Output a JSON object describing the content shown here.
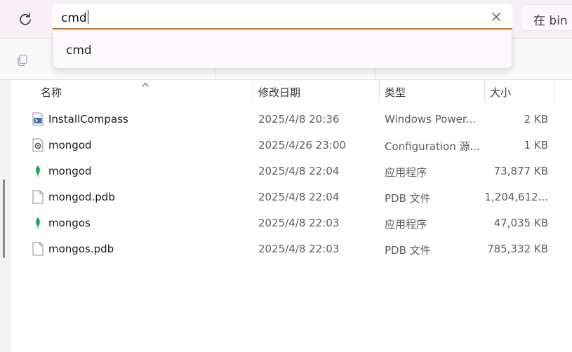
{
  "address_bar": {
    "value": "cmd"
  },
  "search": {
    "placeholder": "在 bin 中"
  },
  "suggestions": [
    {
      "label": "cmd"
    }
  ],
  "columns": {
    "name": "名称",
    "date": "修改日期",
    "type": "类型",
    "size": "大小"
  },
  "files": [
    {
      "icon": "powershell-script-icon",
      "name": "InstallCompass",
      "date": "2025/4/8 20:36",
      "type": "Windows Power...",
      "size": "2 KB"
    },
    {
      "icon": "config-file-icon",
      "name": "mongod",
      "date": "2025/4/26 23:00",
      "type": "Configuration 源...",
      "size": "1 KB"
    },
    {
      "icon": "mongodb-leaf-icon",
      "name": "mongod",
      "date": "2025/4/8 22:04",
      "type": "应用程序",
      "size": "73,877 KB"
    },
    {
      "icon": "blank-file-icon",
      "name": "mongod.pdb",
      "date": "2025/4/8 22:04",
      "type": "PDB 文件",
      "size": "1,204,612..."
    },
    {
      "icon": "mongodb-leaf-icon",
      "name": "mongos",
      "date": "2025/4/8 22:03",
      "type": "应用程序",
      "size": "47,035 KB"
    },
    {
      "icon": "blank-file-icon",
      "name": "mongos.pdb",
      "date": "2025/4/8 22:03",
      "type": "PDB 文件",
      "size": "785,332 KB"
    }
  ],
  "colors": {
    "accent": "#d66b1f",
    "leaf": "#13aa52",
    "topbar": "#f7f1f7"
  }
}
